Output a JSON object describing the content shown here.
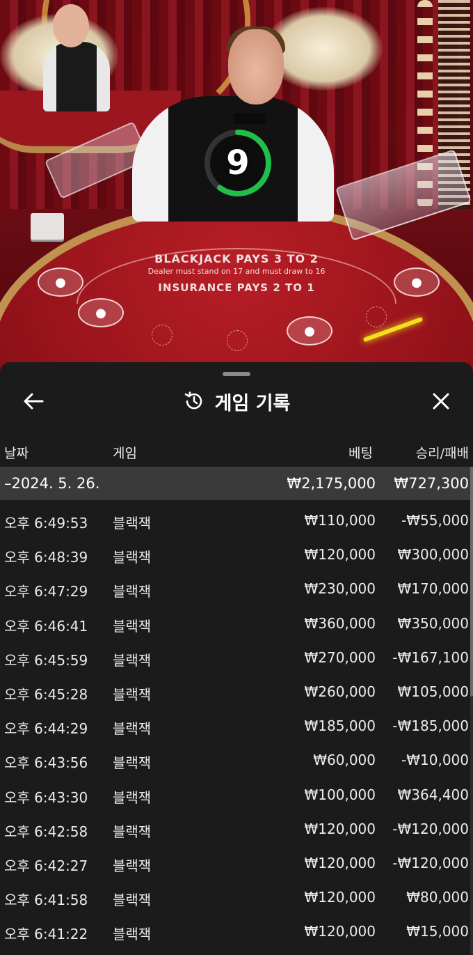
{
  "stage": {
    "timer_value": "9",
    "timer_progress": 0.6,
    "table_line1": "BLACKJACK PAYS 3 TO 2",
    "table_line2": "Dealer must stand on 17 and must draw to 16",
    "table_line3": "INSURANCE PAYS 2 TO 1"
  },
  "sheet": {
    "title": "게임 기록",
    "back_icon": "arrow-left-icon",
    "history_icon": "history-icon",
    "close_icon": "close-icon"
  },
  "columns": {
    "date": "날짜",
    "game": "게임",
    "bet": "베팅",
    "result": "승리/패배"
  },
  "summary": {
    "date": "–2024. 5. 26.",
    "bet": "₩2,175,000",
    "result": "₩727,300"
  },
  "rows": [
    {
      "time": "오후 6:49:53",
      "game": "블랙잭",
      "bet": "₩110,000",
      "result": "-₩55,000"
    },
    {
      "time": "오후 6:48:39",
      "game": "블랙잭",
      "bet": "₩120,000",
      "result": "₩300,000"
    },
    {
      "time": "오후 6:47:29",
      "game": "블랙잭",
      "bet": "₩230,000",
      "result": "₩170,000"
    },
    {
      "time": "오후 6:46:41",
      "game": "블랙잭",
      "bet": "₩360,000",
      "result": "₩350,000"
    },
    {
      "time": "오후 6:45:59",
      "game": "블랙잭",
      "bet": "₩270,000",
      "result": "-₩167,100"
    },
    {
      "time": "오후 6:45:28",
      "game": "블랙잭",
      "bet": "₩260,000",
      "result": "₩105,000"
    },
    {
      "time": "오후 6:44:29",
      "game": "블랙잭",
      "bet": "₩185,000",
      "result": "-₩185,000"
    },
    {
      "time": "오후 6:43:56",
      "game": "블랙잭",
      "bet": "₩60,000",
      "result": "-₩10,000"
    },
    {
      "time": "오후 6:43:30",
      "game": "블랙잭",
      "bet": "₩100,000",
      "result": "₩364,400"
    },
    {
      "time": "오후 6:42:58",
      "game": "블랙잭",
      "bet": "₩120,000",
      "result": "-₩120,000"
    },
    {
      "time": "오후 6:42:27",
      "game": "블랙잭",
      "bet": "₩120,000",
      "result": "-₩120,000"
    },
    {
      "time": "오후 6:41:58",
      "game": "블랙잭",
      "bet": "₩120,000",
      "result": "₩80,000"
    },
    {
      "time": "오후 6:41:22",
      "game": "블랙잭",
      "bet": "₩120,000",
      "result": "₩15,000"
    }
  ]
}
